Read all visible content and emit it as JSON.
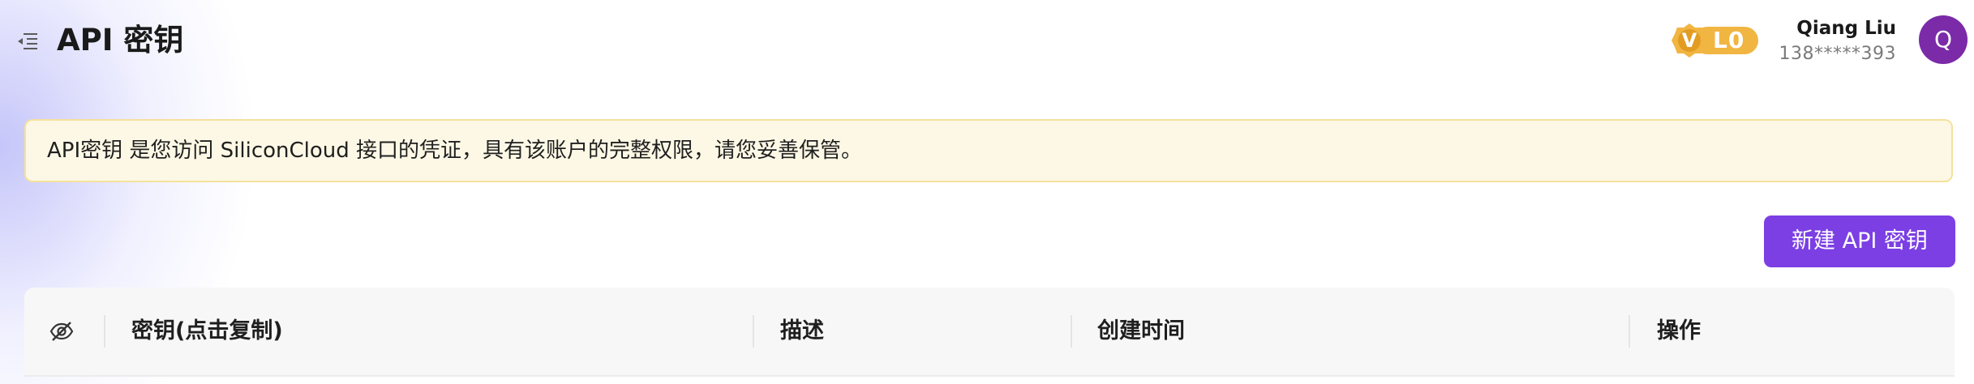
{
  "header": {
    "title": "API 密钥",
    "menu_icon": "menu-fold-icon"
  },
  "level_badge": {
    "icon_letter": "V",
    "label": "L0",
    "color": "#f1b541"
  },
  "user": {
    "name": "Qiang Liu",
    "phone": "138*****393",
    "avatar_initial": "Q",
    "avatar_color": "#7b2aa8"
  },
  "notice": {
    "text": "API密钥 是您访问 SiliconCloud 接口的凭证，具有该账户的完整权限，请您妥善保管。"
  },
  "actions": {
    "create_label": "新建 API 密钥",
    "accent_color": "#7b3fe4"
  },
  "table": {
    "visibility_icon": "eye-off-icon",
    "columns": [
      "密钥(点击复制)",
      "描述",
      "创建时间",
      "操作"
    ]
  }
}
